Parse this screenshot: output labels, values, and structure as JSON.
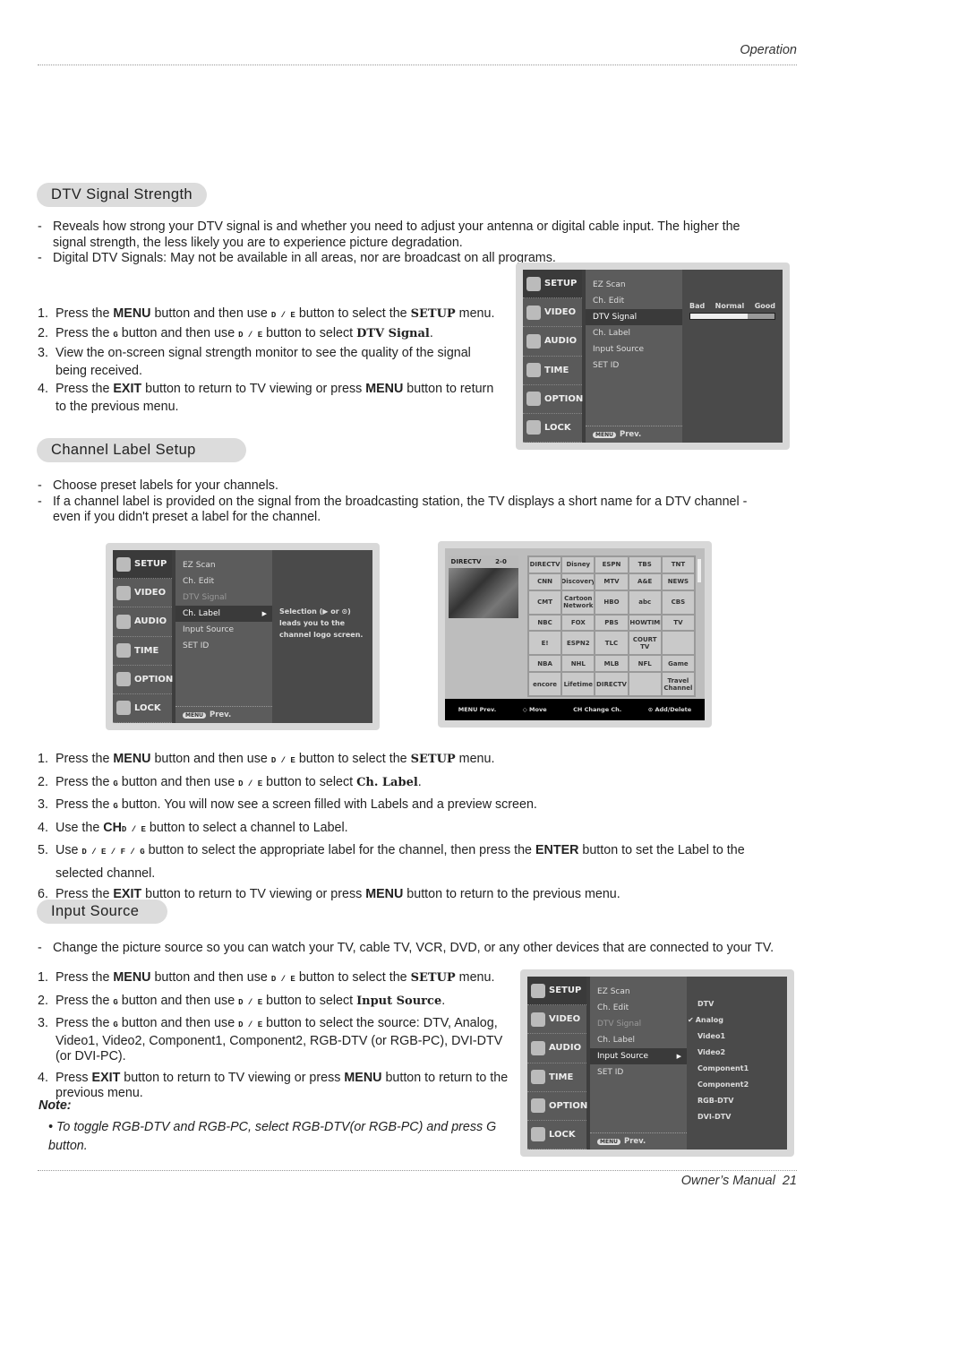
{
  "header": {
    "section": "Operation"
  },
  "footer": {
    "title": "Owner’s Manual",
    "page": "21"
  },
  "sections": [
    {
      "title": "DTV Signal Strength",
      "bullets": [
        "Reveals how strong your DTV signal is and whether you need to adjust your antenna or digital cable input. The higher the signal strength, the less likely you are to experience picture degradation.",
        "Digital DTV Signals: May not be available in all areas,  nor are broadcast on all programs."
      ],
      "steps": [
        [
          [
            "Press the "
          ],
          [
            "MENU",
            "b"
          ],
          [
            " button and then use "
          ],
          [
            "D / E",
            "s"
          ],
          [
            " button to select the "
          ],
          [
            "SETUP",
            "f"
          ],
          [
            " menu."
          ]
        ],
        [
          [
            "Press the "
          ],
          [
            "G",
            "s"
          ],
          [
            " button and then use "
          ],
          [
            "D / E",
            "s"
          ],
          [
            " button to select "
          ],
          [
            "DTV Signal",
            "f"
          ],
          [
            "."
          ]
        ],
        [
          [
            "View the on-screen signal strength monitor to see the quality of the signal being received."
          ]
        ],
        [
          [
            "Press the "
          ],
          [
            "EXIT",
            "b"
          ],
          [
            " button to return to TV viewing or press "
          ],
          [
            "MENU",
            "b"
          ],
          [
            " button to return to the previous menu."
          ]
        ]
      ]
    },
    {
      "title": "Channel Label Setup",
      "bullets": [
        "Choose preset labels for your channels.",
        "If a channel label is provided on the signal from the broadcasting station, the TV displays a short name for a DTV channel - even if you didn't preset a label for the channel."
      ],
      "steps": [
        [
          [
            "Press the "
          ],
          [
            "MENU",
            "b"
          ],
          [
            " button and then use "
          ],
          [
            "D / E",
            "s"
          ],
          [
            " button to select the "
          ],
          [
            "SETUP",
            "f"
          ],
          [
            " menu."
          ]
        ],
        [
          [
            "Press the "
          ],
          [
            "G",
            "s"
          ],
          [
            " button and then use "
          ],
          [
            "D / E",
            "s"
          ],
          [
            " button to select "
          ],
          [
            "Ch. Label",
            "f"
          ],
          [
            "."
          ]
        ],
        [
          [
            "Press the "
          ],
          [
            "G",
            "s"
          ],
          [
            " button. You will now see a screen filled with Labels and a preview screen."
          ]
        ],
        [
          [
            "Use the "
          ],
          [
            "CH",
            "b"
          ],
          [
            "D / E",
            "s"
          ],
          [
            " button to select a channel to Label."
          ]
        ],
        [
          [
            "Use "
          ],
          [
            "D / E / F / G",
            "s"
          ],
          [
            " button to select the appropriate label for the channel, then press the "
          ],
          [
            "ENTER",
            "b"
          ],
          [
            " button to set the Label to the selected channel."
          ]
        ],
        [
          [
            "Press the "
          ],
          [
            "EXIT",
            "b"
          ],
          [
            " button to return to TV viewing or press "
          ],
          [
            "MENU",
            "b"
          ],
          [
            " button to return to the previous menu."
          ]
        ]
      ]
    },
    {
      "title": "Input Source",
      "bullets": [
        "Change the picture source so you can watch your TV, cable TV, VCR, DVD, or any other devices that are connected to your TV."
      ],
      "steps": [
        [
          [
            "Press the "
          ],
          [
            "MENU",
            "b"
          ],
          [
            " button and then use "
          ],
          [
            "D / E",
            "s"
          ],
          [
            " button to select the "
          ],
          [
            "SETUP",
            "f"
          ],
          [
            " menu."
          ]
        ],
        [
          [
            "Press the "
          ],
          [
            "G",
            "s"
          ],
          [
            " button and then use "
          ],
          [
            "D / E",
            "s"
          ],
          [
            " button to select "
          ],
          [
            "Input Source",
            "f"
          ],
          [
            "."
          ]
        ],
        [
          [
            "Press the "
          ],
          [
            "G",
            "s"
          ],
          [
            " button and then use "
          ],
          [
            "D / E",
            "s"
          ],
          [
            " button to select the source: DTV, Analog, Video1, Video2, Component1, Component2, RGB-DTV (or RGB-PC), DVI-DTV (or DVI-PC)."
          ]
        ],
        [
          [
            "Press "
          ],
          [
            "EXIT",
            "b"
          ],
          [
            " button to return to TV viewing or press "
          ],
          [
            "MENU",
            "b"
          ],
          [
            " button to return to the previous menu."
          ]
        ]
      ],
      "note_label": "Note:",
      "note": "• To toggle RGB-DTV and RGB-PC, select RGB-DTV(or RGB-PC) and press G button."
    }
  ],
  "menus": [
    {
      "left": [
        "SETUP",
        "VIDEO",
        "AUDIO",
        "TIME",
        "OPTION",
        "LOCK"
      ],
      "items": [
        "EZ Scan",
        "Ch. Edit",
        "DTV Signal",
        "Ch. Label",
        "Input Source",
        "SET ID"
      ],
      "selected": 2,
      "dim": -1,
      "prev": "Prev.",
      "menu_key": "MENU",
      "right": {
        "type": "signal",
        "labels": [
          "Bad",
          "Normal",
          "Good"
        ],
        "signal_level": 0.68
      }
    },
    {
      "left": [
        "SETUP",
        "VIDEO",
        "AUDIO",
        "TIME",
        "OPTION",
        "LOCK"
      ],
      "items": [
        "EZ Scan",
        "Ch. Edit",
        "DTV Signal",
        "Ch. Label",
        "Input Source",
        "SET ID"
      ],
      "selected": 3,
      "dim": 2,
      "prev": "Prev.",
      "menu_key": "MENU",
      "right": {
        "type": "help",
        "text": "Selection (▶ or ⊙) leads you to the channel logo screen."
      }
    },
    {
      "left": [
        "SETUP",
        "VIDEO",
        "AUDIO",
        "TIME",
        "OPTION",
        "LOCK"
      ],
      "items": [
        "EZ Scan",
        "Ch. Edit",
        "DTV Signal",
        "Ch. Label",
        "Input Source",
        "SET ID"
      ],
      "selected": 4,
      "dim": 2,
      "prev": "Prev.",
      "menu_key": "MENU",
      "right": {
        "type": "list",
        "options": [
          "DTV",
          "Analog",
          "Video1",
          "Video2",
          "Component1",
          "Component2",
          "RGB-DTV",
          "DVI-DTV"
        ],
        "checked": 1
      }
    }
  ],
  "channel_label": {
    "preview_channel": "2-0",
    "preview_logo": "DIRECTV",
    "logos": [
      "DIRECTV",
      "Disney",
      "ESPN",
      "TBS",
      "TNT",
      "CNN",
      "Discovery",
      "MTV",
      "A&E",
      "NEWS",
      "CMT",
      "Cartoon Network",
      "HBO",
      "abc",
      "CBS",
      "NBC",
      "FOX",
      "PBS",
      "SHOWTIME",
      "TV",
      "E!",
      "ESPN2",
      "TLC",
      "COURT TV",
      "",
      "NBA",
      "NHL",
      "MLB",
      "NFL",
      "Game",
      "encore",
      "Lifetime",
      "DIRECTV",
      "",
      "Travel Channel"
    ],
    "bar": [
      "MENU Prev.",
      "◇ Move",
      "CH Change Ch.",
      "⊙ Add/Delete"
    ]
  }
}
